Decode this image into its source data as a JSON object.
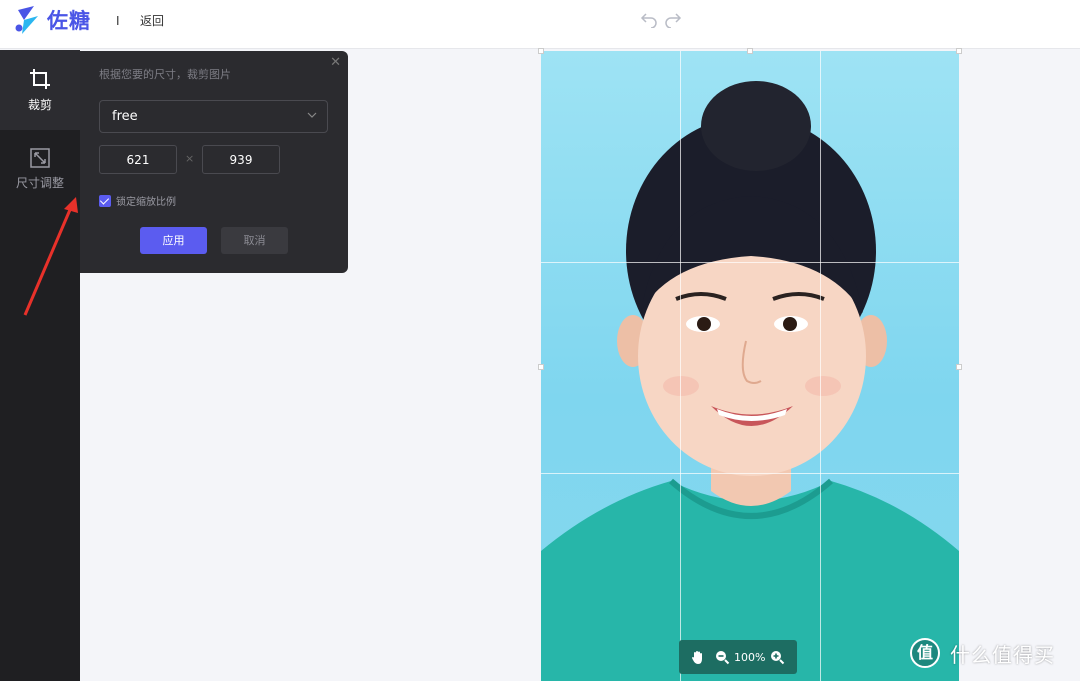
{
  "header": {
    "brand": "佐糖",
    "separator": "I",
    "back_label": "返回",
    "icons": [
      "undo-icon",
      "redo-icon"
    ]
  },
  "rail": {
    "tools": [
      {
        "label": "裁剪",
        "icon": "crop-icon",
        "active": true
      },
      {
        "label": "尺寸调整",
        "icon": "resize-icon",
        "active": false
      }
    ]
  },
  "crop_panel": {
    "hint": "根据您要的尺寸，裁剪图片",
    "ratio_value": "free",
    "width_value": "621",
    "height_value": "939",
    "times_sign": "×",
    "lock_label": "锁定缩放比例",
    "lock_checked": true,
    "apply_label": "应用",
    "cancel_label": "取消"
  },
  "zoom": {
    "value": "100%"
  },
  "watermark": {
    "badge": "值",
    "text": "什么值得买"
  },
  "colors": {
    "brand": "#4a55e6",
    "accent": "#5b5cf0",
    "rail_bg": "#1f1f22",
    "panel_bg": "#2b2b2f",
    "annotation": "#e8312a"
  }
}
